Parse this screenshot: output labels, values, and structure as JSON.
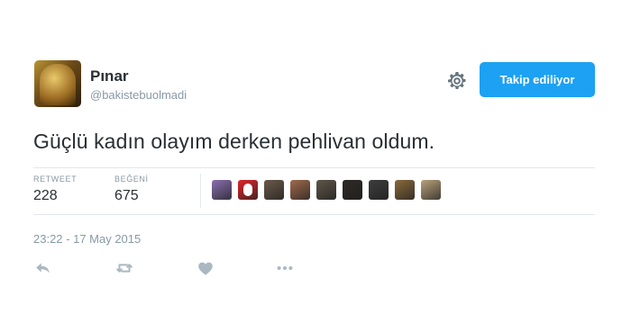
{
  "user": {
    "name": "Pınar",
    "handle": "@bakistebuolmadi"
  },
  "header": {
    "follow_button_label": "Takip ediliyor",
    "settings_icon": "gear-icon"
  },
  "tweet": {
    "text": "Güçlü kadın olayım derken pehlivan oldum.",
    "timestamp": "23:22 - 17 May 2015"
  },
  "stats": {
    "retweet_label": "RETWEET",
    "retweet_count": "228",
    "likes_label": "BEĞENİ",
    "likes_count": "675"
  },
  "likers": [
    {
      "icon": "avatar",
      "color": "#8a6fb0"
    },
    {
      "icon": "avatar",
      "color": "#e0262b"
    },
    {
      "icon": "avatar",
      "color": "#6b5a4a"
    },
    {
      "icon": "avatar",
      "color": "#a06b4d"
    },
    {
      "icon": "avatar",
      "color": "#5e5548"
    },
    {
      "icon": "avatar",
      "color": "#2e2a26"
    },
    {
      "icon": "avatar",
      "color": "#3d3d3d"
    },
    {
      "icon": "avatar",
      "color": "#8a6a3c"
    },
    {
      "icon": "avatar",
      "color": "#b9a27c"
    }
  ],
  "actions": [
    "reply-icon",
    "retweet-icon",
    "like-icon",
    "more-icon"
  ],
  "colors": {
    "accent": "#1da1f2",
    "text": "#292f33",
    "muted": "#8899a6",
    "icon": "#aab8c2"
  }
}
